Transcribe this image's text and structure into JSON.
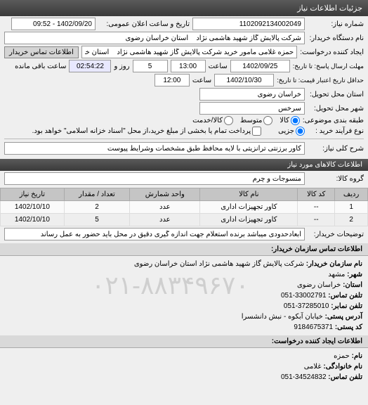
{
  "header": {
    "title": "جزئیات اطلاعات نیاز"
  },
  "fields": {
    "req_no_lbl": "شماره نیاز:",
    "req_no": "1102092134002049",
    "ann_datetime_lbl": "تاریخ و ساعت اعلان عمومی:",
    "ann_datetime": "1402/09/20 - 09:52",
    "buyer_org_lbl": "نام دستگاه خریدار:",
    "buyer_org": "شرکت پالایش گاز شهید هاشمی نژاد    استان خراسان رضوی",
    "req_creator_lbl": "ایجاد کننده درخواست:",
    "req_creator": "حمزه غلامی مامور خرید شرکت پالایش گاز شهید هاشمی نژاد    استان خراسا",
    "contact_btn": "اطلاعات تماس خریدار",
    "deadline_resp_lbl": "مهلت ارسال پاسخ: تا تاریخ:",
    "deadline_resp_date": "1402/09/25",
    "time_lbl": "ساعت",
    "deadline_resp_time": "13:00",
    "days_5": "5",
    "days_lbl": "روز و",
    "remain_time": "02:54:22",
    "remain_lbl": "ساعت باقی مانده",
    "deadline_del_lbl": "حداقل تاریخ اعتبار قیمت: تا تاریخ:",
    "deadline_del_date": "1402/10/30",
    "deadline_del_time": "12:00",
    "province_lbl": "استان محل تحویل:",
    "province": "خراسان رضوی",
    "city_lbl": "شهر محل تحویل:",
    "city": "سرخس",
    "cat_disp_lbl": "طبقه بندی موضوعی:",
    "cat_all": "کالا",
    "cat_middle": "متوسط",
    "cat_low": "کالا/خدمت",
    "buy_type_lbl": "نوع فرآیند خرید :",
    "partial": "جزیی",
    "note": "پرداخت تمام یا بخشی از مبلغ خرید،از محل \"اسناد خزانه اسلامی\" خواهد بود.",
    "subject_lbl": "شرح کلی نیاز:",
    "subject": "کاور برزنتی ترانزیتی با لایه محافظ طبق مشخصات وشرایط پیوست",
    "goods_header": "اطلاعات کالاهای مورد نیاز",
    "group_lbl": "گروه کالا:",
    "group": "منسوجات و چرم"
  },
  "table": {
    "cols": [
      "ردیف",
      "کد کالا",
      "نام کالا",
      "واحد شمارش",
      "تعداد / مقدار",
      "تاریخ نیاز"
    ],
    "rows": [
      [
        "1",
        "--",
        "کاور تجهیزات اداری",
        "عدد",
        "2",
        "1402/10/10"
      ],
      [
        "2",
        "--",
        "کاور تجهیزات اداری",
        "عدد",
        "5",
        "1402/10/10"
      ]
    ]
  },
  "buyer_note": {
    "lbl": "توضیحات خریدار:",
    "txt": "ابعادحدودی میباشد برنده استعلام جهت اندازه گیری دقیق در محل باید حضور به عمل رساند"
  },
  "contact_header": "اطلاعات تماس سازمان خریدار:",
  "contact": {
    "org_lbl": "نام سازمان خریدار:",
    "org": "شرکت پالایش گاز شهید هاشمی نژاد استان خراسان رضوی",
    "city_lbl": "شهر:",
    "city": "مشهد",
    "province_lbl": "استان:",
    "province": "خراسان رضوی",
    "phone_lbl": "تلفن تماس:",
    "phone": "33002791-051",
    "fax_lbl": "تلفن نمابر:",
    "fax": "37285010-051",
    "addr_lbl": "آدرس پستی:",
    "addr": "خیابان آبکوه - نبش دانشسرا",
    "post_lbl": "کد پستی:",
    "post": "9184675371"
  },
  "creator_header": "اطلاعات ایجاد کننده درخواست:",
  "creator": {
    "name_lbl": "نام:",
    "name": "حمزه",
    "family_lbl": "نام خانوادگی:",
    "family": "غلامی",
    "phone_lbl": "تلفن تماس:",
    "phone": "34524832-051"
  },
  "watermark": "۰۲۱-۸۸۳۴۹۶۷۰"
}
